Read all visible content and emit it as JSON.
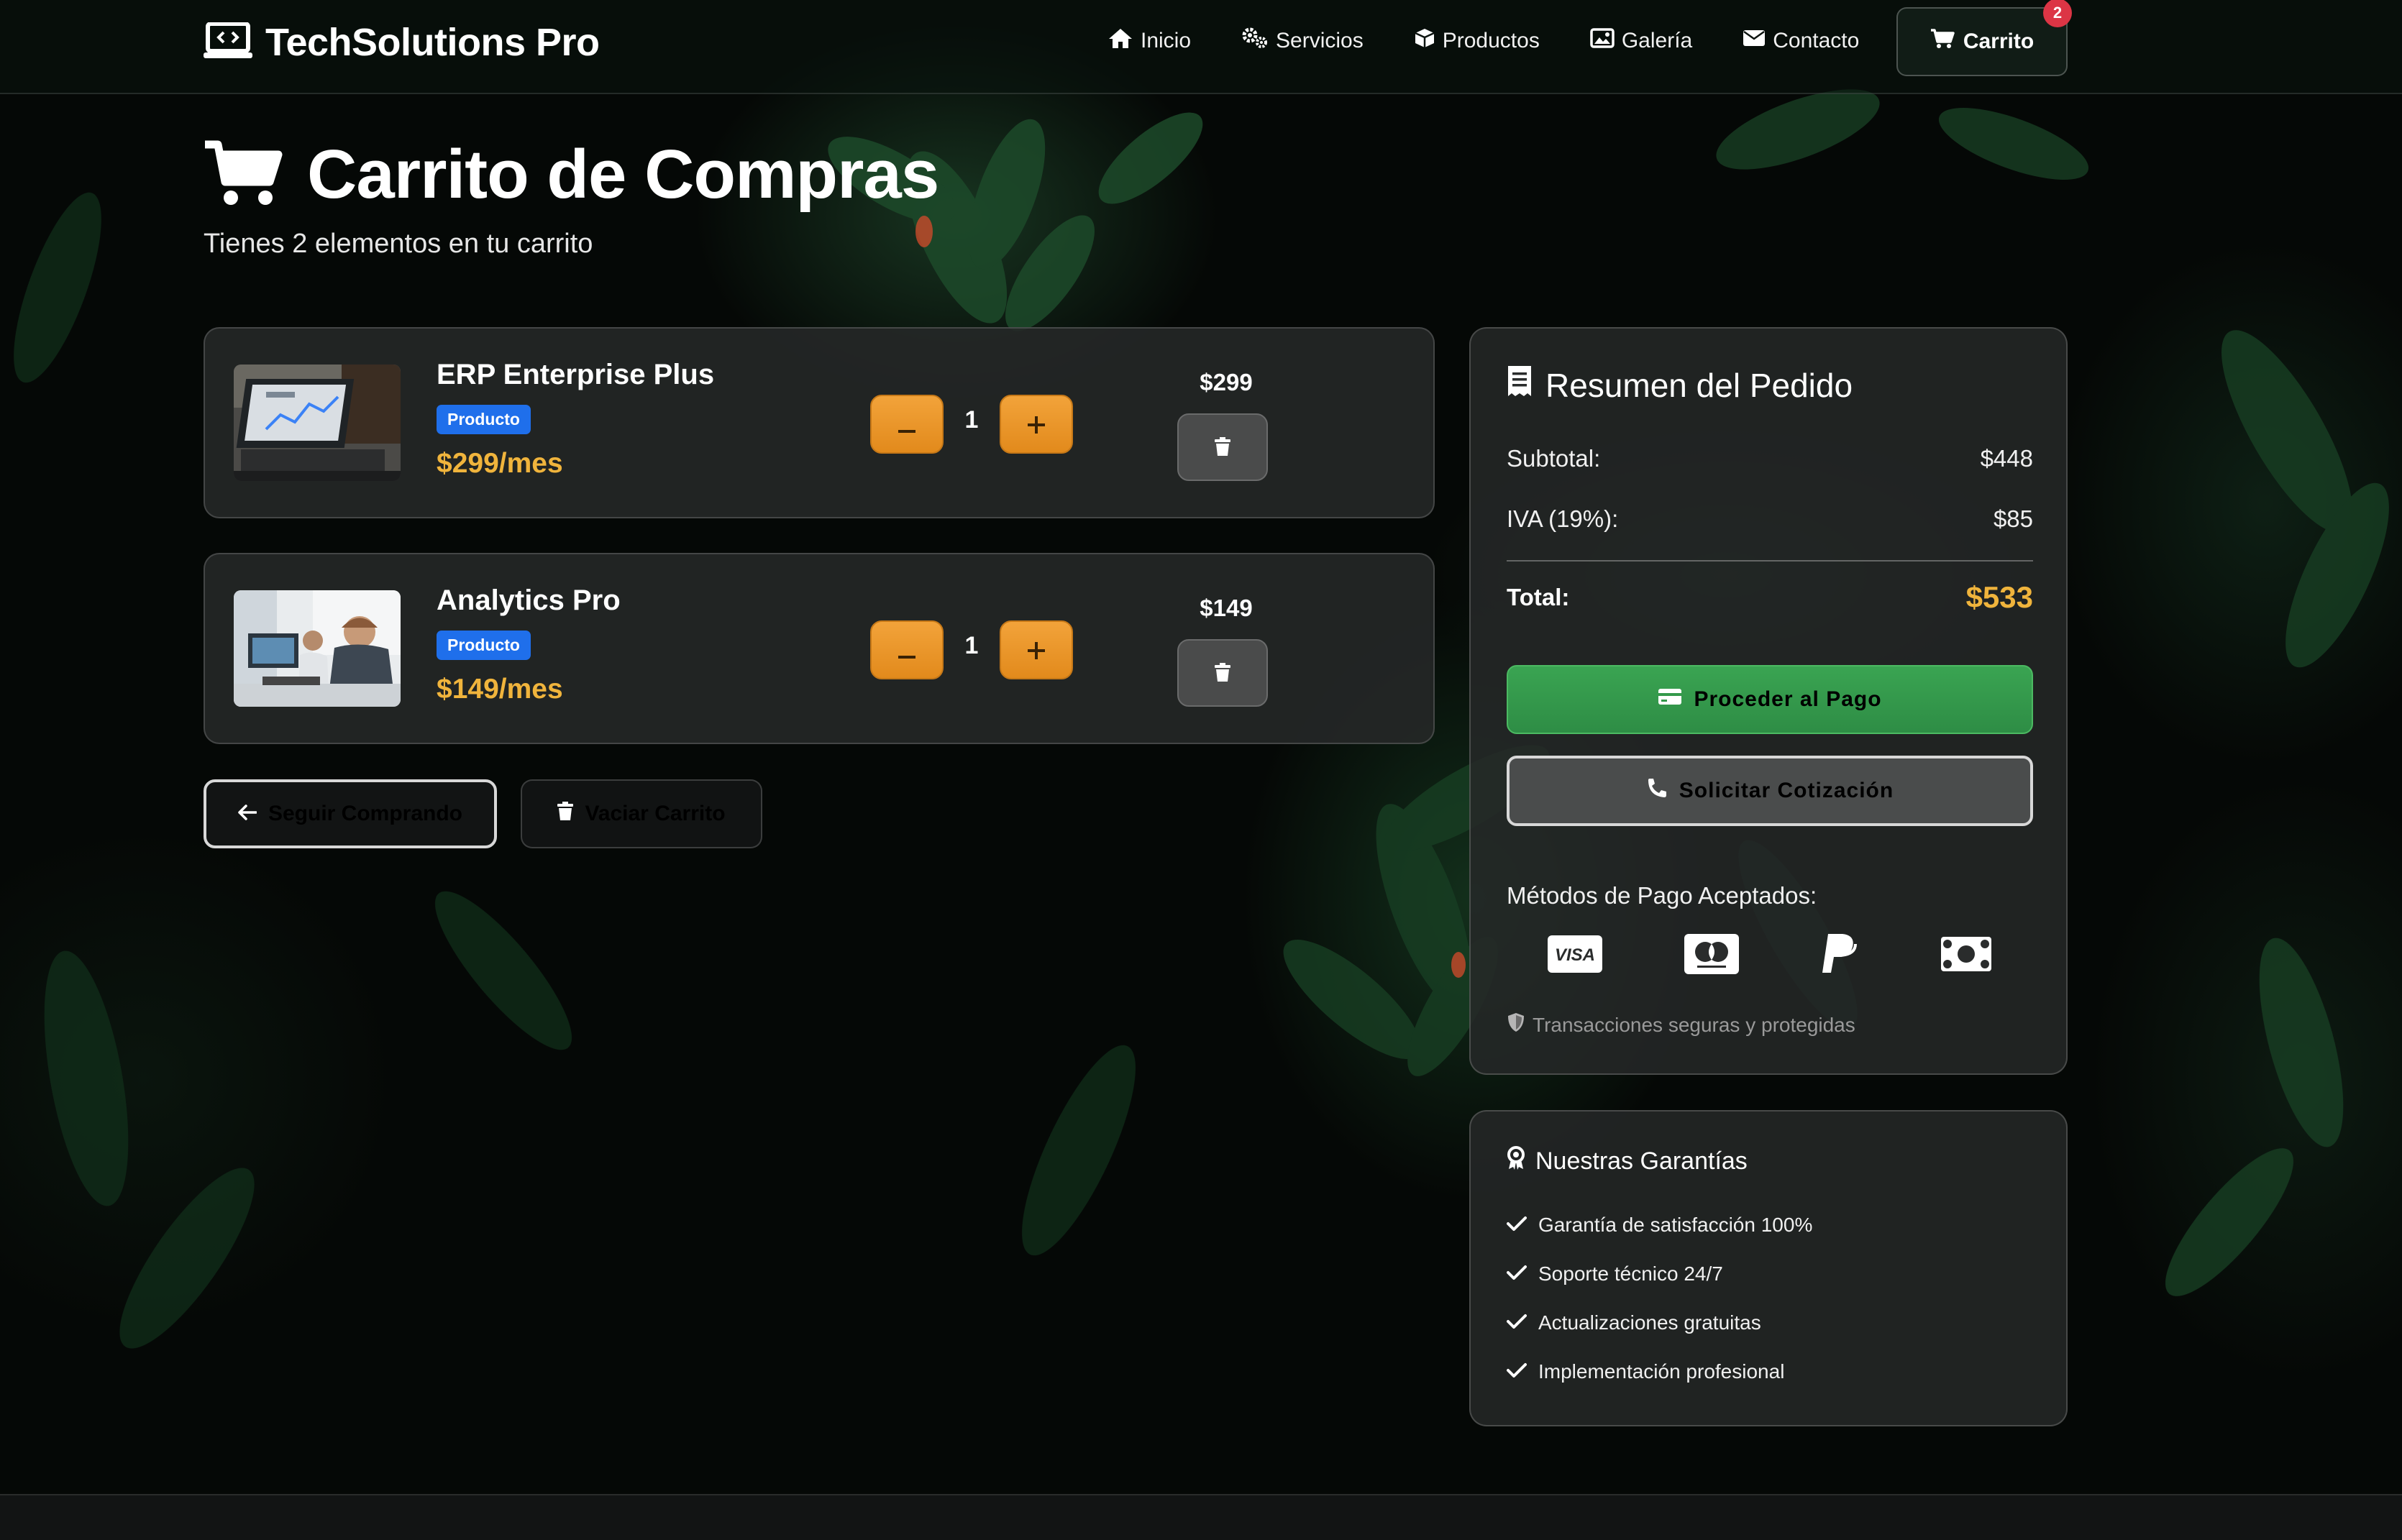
{
  "brand": {
    "name": "TechSolutions Pro"
  },
  "nav": {
    "items": [
      "Inicio",
      "Servicios",
      "Productos",
      "Galería",
      "Contacto"
    ],
    "cart_label": "Carrito",
    "cart_count": "2"
  },
  "page": {
    "title": "Carrito de Compras",
    "subtitle": "Tienes 2 elementos en tu carrito"
  },
  "cart": {
    "items": [
      {
        "name": "ERP Enterprise Plus",
        "tag": "Producto",
        "price": "$299/mes",
        "quantity": "1",
        "line_total": "$299"
      },
      {
        "name": "Analytics Pro",
        "tag": "Producto",
        "price": "$149/mes",
        "quantity": "1",
        "line_total": "$149"
      }
    ],
    "continue_label": "Seguir Comprando",
    "clear_label": "Vaciar Carrito"
  },
  "summary": {
    "title": "Resumen del Pedido",
    "subtotal_label": "Subtotal:",
    "subtotal_value": "$448",
    "tax_label": "IVA (19%):",
    "tax_value": "$85",
    "total_label": "Total:",
    "total_value": "$533",
    "pay_label": "Proceder al Pago",
    "quote_label": "Solicitar Cotización",
    "methods_label": "Métodos de Pago Aceptados:",
    "methods": [
      "visa-icon",
      "mastercard-icon",
      "paypal-icon",
      "cash-icon"
    ],
    "visa_text": "VISA",
    "secure_text": "Transacciones seguras y protegidas"
  },
  "guarantees": {
    "title": "Nuestras Garantías",
    "items": [
      "Garantía de satisfacción 100%",
      "Soporte técnico 24/7",
      "Actualizaciones gratuitas",
      "Implementación profesional"
    ]
  },
  "colors": {
    "accent_gold": "#f0b43c",
    "qty_orange": "#e8951f",
    "tag_blue": "#1f6feb",
    "pay_green": "#34994b",
    "badge_red": "#dc3545"
  }
}
